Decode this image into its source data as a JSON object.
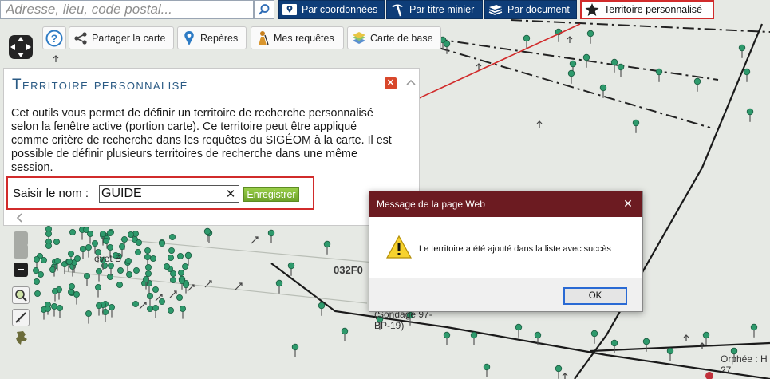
{
  "search": {
    "placeholder": "Adresse, lieu, code postal..."
  },
  "nav": {
    "coords": "Par coordonnées",
    "mining": "Par titre minier",
    "document": "Par document",
    "territory": "Territoire personnalisé"
  },
  "tools": {
    "share": "Partager la carte",
    "markers": "Repères",
    "queries": "Mes requêtes",
    "basemap": "Carte de base"
  },
  "panel": {
    "title": "Territoire personnalisé",
    "description": "Cet outils vous permet de définir un territoire de recherche personnalisé selon la fenêtre active (portion carte). Ce territoire peut être appliqué comme critère de recherche dans les requêtes du SIGÉOM à la carte. Il est possible de définir plusieurs territoires de recherche dans une même session.",
    "name_label": "Saisir le nom :",
    "name_value": "GUIDE",
    "clear": "✕",
    "save": "Enregistrer"
  },
  "dialog": {
    "title": "Message de la page Web",
    "message": "Le territoire a été ajouté dans la liste avec succès",
    "ok": "OK"
  },
  "map_labels": {
    "sheet": "032F0",
    "place": "evet B",
    "drill": "(Sondage 97-",
    "drill2": "BP-19)",
    "orphee": "Orphée : H",
    "orphee2": "27"
  },
  "colors": {
    "nav_blue": "#0e3d78",
    "highlight_red": "#d12b2b",
    "save_green": "#7cb534",
    "dialog_title": "#6c1b21",
    "marker_green": "#2e9a6c"
  }
}
